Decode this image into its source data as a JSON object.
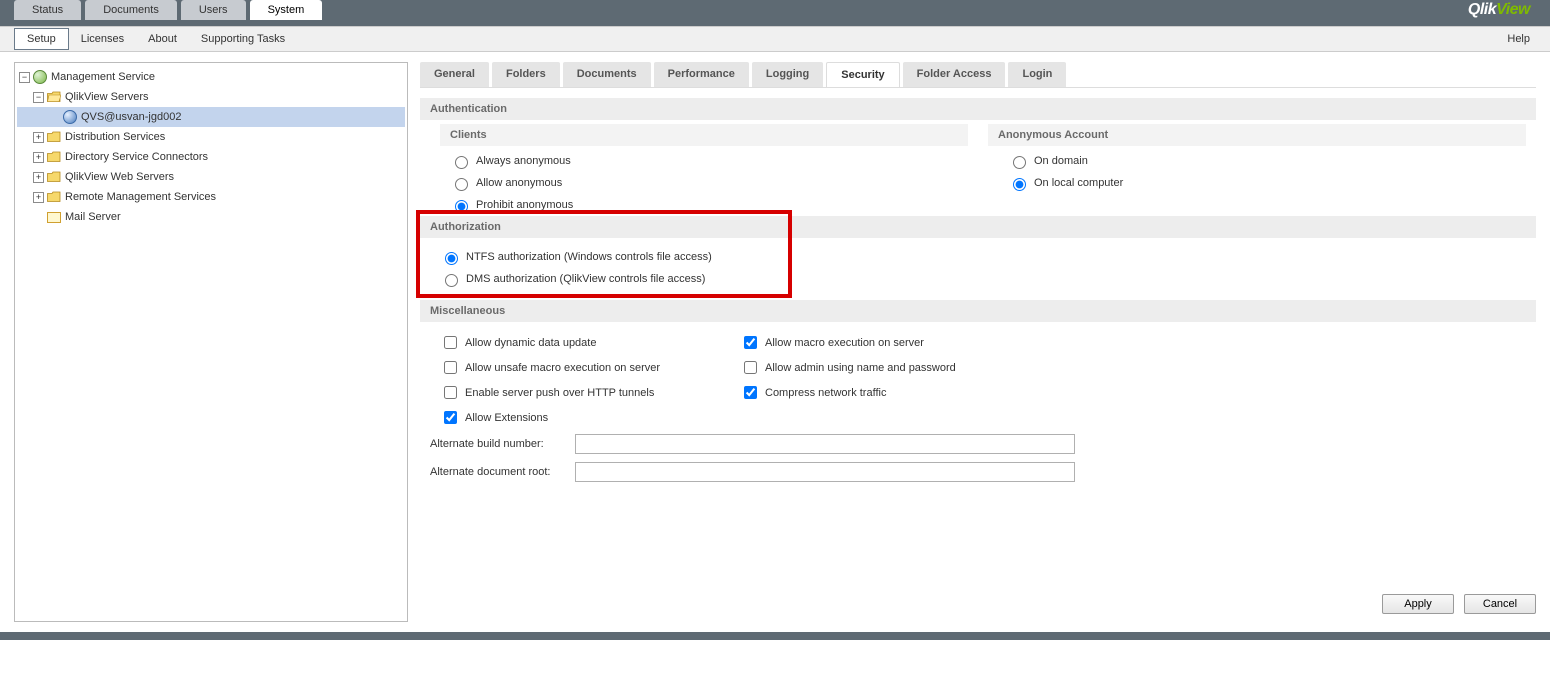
{
  "brand": {
    "part1": "Qlik",
    "part2": "View"
  },
  "topTabs": {
    "status": "Status",
    "documents": "Documents",
    "users": "Users",
    "system": "System"
  },
  "subNav": {
    "setup": "Setup",
    "licenses": "Licenses",
    "about": "About",
    "supporting": "Supporting Tasks",
    "help": "Help"
  },
  "tree": {
    "root": "Management Service",
    "qvservers": "QlikView Servers",
    "server1": "QVS@usvan-jgd002",
    "dist": "Distribution Services",
    "dsc": "Directory Service Connectors",
    "qvweb": "QlikView Web Servers",
    "rms": "Remote Management Services",
    "mail": "Mail Server"
  },
  "contentTabs": {
    "general": "General",
    "folders": "Folders",
    "documents": "Documents",
    "performance": "Performance",
    "logging": "Logging",
    "security": "Security",
    "folderaccess": "Folder Access",
    "login": "Login"
  },
  "sections": {
    "authentication": "Authentication",
    "clients": "Clients",
    "anonymousAccount": "Anonymous Account",
    "authorization": "Authorization",
    "misc": "Miscellaneous"
  },
  "clients": {
    "always": "Always anonymous",
    "allow": "Allow anonymous",
    "prohibit": "Prohibit anonymous"
  },
  "anon": {
    "domain": "On domain",
    "local": "On local computer"
  },
  "authz": {
    "ntfs": "NTFS authorization (Windows controls file access)",
    "dms": "DMS authorization (QlikView controls file access)"
  },
  "misc": {
    "dynamic": "Allow dynamic data update",
    "unsafemacro": "Allow unsafe macro execution on server",
    "pushhttp": "Enable server push over HTTP tunnels",
    "extensions": "Allow Extensions",
    "macroserver": "Allow macro execution on server",
    "adminname": "Allow admin using name and password",
    "compress": "Compress network traffic"
  },
  "fields": {
    "altbuild": "Alternate build number:",
    "altdoc": "Alternate document root:",
    "altbuild_val": "",
    "altdoc_val": ""
  },
  "buttons": {
    "apply": "Apply",
    "cancel": "Cancel"
  }
}
